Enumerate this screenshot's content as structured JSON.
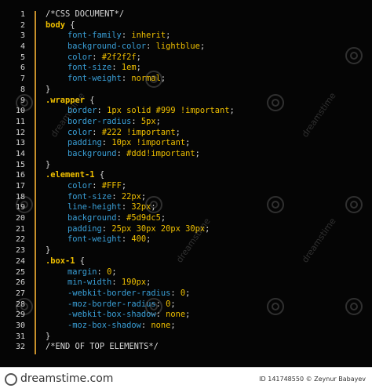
{
  "editor": {
    "line_numbers": [
      "1",
      "2",
      "3",
      "4",
      "5",
      "6",
      "7",
      "8",
      "9",
      "10",
      "11",
      "12",
      "13",
      "14",
      "15",
      "16",
      "17",
      "18",
      "19",
      "20",
      "21",
      "22",
      "23",
      "24",
      "25",
      "26",
      "27",
      "28",
      "29",
      "30",
      "31",
      "32"
    ],
    "lines": [
      {
        "kind": "comment",
        "text": "/*CSS DOCUMENT*/"
      },
      {
        "kind": "selector",
        "sel": "body",
        "brace": " {"
      },
      {
        "kind": "decl",
        "prop": "font-family",
        "val": "inherit"
      },
      {
        "kind": "decl",
        "prop": "background-color",
        "val": "lightblue"
      },
      {
        "kind": "decl",
        "prop": "color",
        "val": "#2f2f2f"
      },
      {
        "kind": "decl",
        "prop": "font-size",
        "val": "1em"
      },
      {
        "kind": "decl",
        "prop": "font-weight",
        "val": "normal"
      },
      {
        "kind": "close",
        "text": "}"
      },
      {
        "kind": "selector",
        "sel": ".wrapper",
        "brace": " {"
      },
      {
        "kind": "decl",
        "prop": "border",
        "val": "1px solid #999 !important"
      },
      {
        "kind": "decl",
        "prop": "border-radius",
        "val": "5px"
      },
      {
        "kind": "decl",
        "prop": "color",
        "val": "#222 !important"
      },
      {
        "kind": "decl",
        "prop": "padding",
        "val": "10px !important"
      },
      {
        "kind": "decl",
        "prop": "background",
        "val": "#ddd!important"
      },
      {
        "kind": "close",
        "text": "}"
      },
      {
        "kind": "selector",
        "sel": ".element-1",
        "brace": " {"
      },
      {
        "kind": "decl",
        "prop": "color",
        "val": "#FFF"
      },
      {
        "kind": "decl",
        "prop": "font-size",
        "val": "22px"
      },
      {
        "kind": "decl",
        "prop": "line-height",
        "val": "32px"
      },
      {
        "kind": "decl",
        "prop": "background",
        "val": "#5d9dc5"
      },
      {
        "kind": "decl",
        "prop": "padding",
        "val": "25px 30px 20px 30px"
      },
      {
        "kind": "decl",
        "prop": "font-weight",
        "val": "400"
      },
      {
        "kind": "close",
        "text": "}"
      },
      {
        "kind": "selector",
        "sel": ".box-1",
        "brace": " {"
      },
      {
        "kind": "decl",
        "prop": "margin",
        "val": "0"
      },
      {
        "kind": "decl",
        "prop": "min-width",
        "val": "190px"
      },
      {
        "kind": "decl",
        "prop": "-webkit-border-radius",
        "val": "0"
      },
      {
        "kind": "decl",
        "prop": "-moz-border-radius",
        "val": "0"
      },
      {
        "kind": "decl",
        "prop": "-webkit-box-shadow",
        "val": "none"
      },
      {
        "kind": "decl",
        "prop": "-moz-box-shadow",
        "val": "none"
      },
      {
        "kind": "close",
        "text": "}"
      },
      {
        "kind": "comment",
        "text": "/*END OF TOP ELEMENTS*/"
      }
    ]
  },
  "watermark": {
    "text": "dreamstime"
  },
  "footer": {
    "logo": "dreamstime.com",
    "id_text": "ID 141748550 © Zeynur Babayev"
  },
  "colors": {
    "selector": "#f0c000",
    "property": "#3aa0d8",
    "value": "#f0c000",
    "gutter_bar": "#c8902a"
  }
}
